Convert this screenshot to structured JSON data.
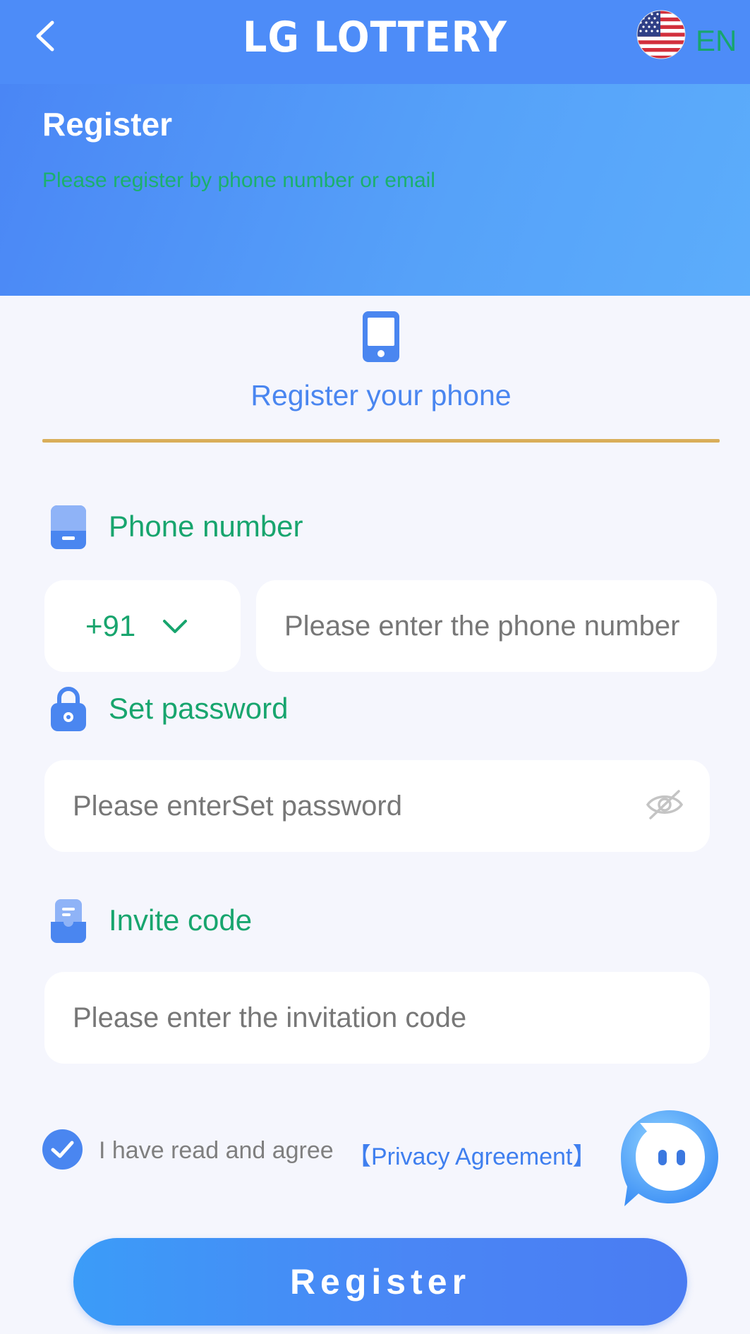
{
  "header": {
    "logo_text": "LG LOTTERY",
    "language": "EN",
    "back_icon": "chevron-left-icon",
    "flag_icon": "us-flag-icon"
  },
  "banner": {
    "title": "Register",
    "subtitle": "Please register by phone number or email"
  },
  "tab": {
    "label": "Register your phone",
    "icon": "smartphone-icon"
  },
  "phone": {
    "label": "Phone number",
    "country_code": "+91",
    "placeholder": "Please enter the phone number",
    "value": ""
  },
  "password": {
    "label": "Set password",
    "placeholder": "Please enterSet password",
    "value": ""
  },
  "invite": {
    "label": "Invite code",
    "placeholder": "Please enter the invitation code",
    "value": ""
  },
  "agreement": {
    "checked": true,
    "text": "I have read and agree",
    "link": "【Privacy Agreement】"
  },
  "actions": {
    "register_label": "Register"
  },
  "colors": {
    "header": "#4d8cf8",
    "accent_blue": "#4a86f0",
    "label_green": "#18a56e",
    "tab_underline": "#d9ae5a",
    "background": "#f5f6fd"
  }
}
